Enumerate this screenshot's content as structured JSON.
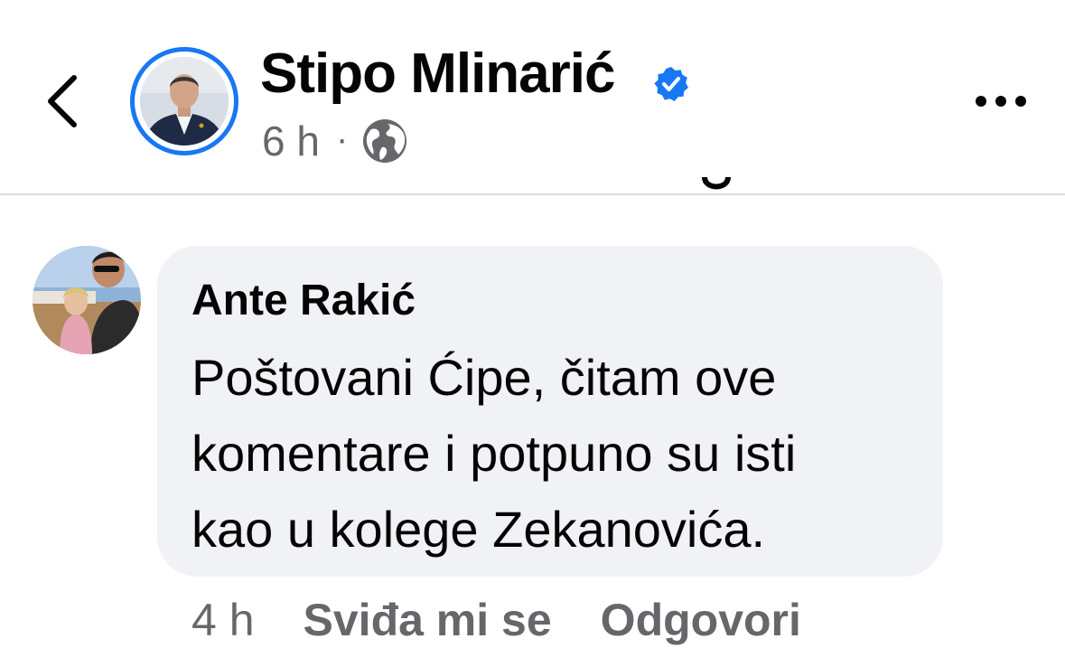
{
  "header": {
    "back_icon": "chevron-left-icon",
    "page_name": "Stipo Mlinarić",
    "verified_icon": "verified-badge-icon",
    "post_time": "6 h",
    "separator": "·",
    "audience_icon": "globe-icon",
    "more_icon": "more-horizontal-icon"
  },
  "comment": {
    "author": "Ante Rakić",
    "text_lines": [
      "Poštovani Ćipe, čitam ove",
      "komentare i potpuno su isti",
      "kao u kolege Zekanovića."
    ],
    "time": "4 h",
    "like_label": "Sviđa mi se",
    "reply_label": "Odgovori"
  },
  "colors": {
    "accent": "#1877f2",
    "secondary_text": "#65676b",
    "bubble_bg": "#f0f2f5",
    "divider": "#dadde1"
  }
}
